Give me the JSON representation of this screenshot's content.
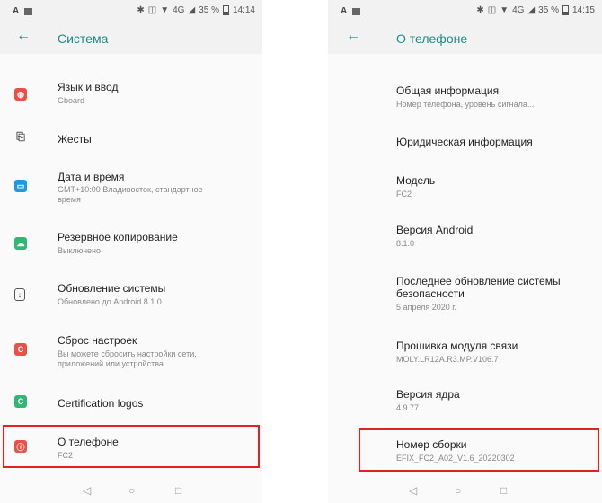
{
  "left": {
    "status": {
      "left_a": "A",
      "network": "4G",
      "battery": "35 %",
      "time": "14:14"
    },
    "title": "Система",
    "items": [
      {
        "title": "Язык и ввод",
        "sub": "Gboard",
        "icon": "globe-icon",
        "color": "#e8504a"
      },
      {
        "title": "Жесты",
        "icon": "gesture-icon",
        "color": "#666666"
      },
      {
        "title": "Дата и время",
        "sub": "GMT+10:00 Владивосток, стандартное",
        "sub2": "время",
        "icon": "clock-icon",
        "color": "#1e9be0"
      },
      {
        "title": "Резервное копирование",
        "sub": "Выключено",
        "icon": "backup-icon",
        "color": "#2eb873"
      },
      {
        "title": "Обновление системы",
        "sub": "Обновлено до Android 8.1.0",
        "icon": "update-icon",
        "color": "#555555"
      },
      {
        "title": "Сброс настроек",
        "sub": "Вы можете сбросить настройки сети,",
        "sub2": "приложений или устройства",
        "icon": "reset-icon",
        "color": "#e8504a"
      },
      {
        "title": "Certification logos",
        "icon": "certification-icon",
        "color": "#2eb873"
      },
      {
        "title": "О телефоне",
        "sub": "FC2",
        "icon": "info-icon",
        "color": "#e8504a"
      }
    ]
  },
  "right": {
    "status": {
      "left_a": "A",
      "network": "4G",
      "battery": "35 %",
      "time": "14:15"
    },
    "title": "О телефоне",
    "items": [
      {
        "title": "Общая информация",
        "sub": "Номер телефона, уровень сигнала..."
      },
      {
        "title": "Юридическая информация"
      },
      {
        "title": "Модель",
        "sub": "FC2"
      },
      {
        "title": "Версия Android",
        "sub": "8.1.0"
      },
      {
        "title": "Последнее обновление системы",
        "title2": "безопасности",
        "sub": "5 апреля 2020 г."
      },
      {
        "title": "Прошивка модуля связи",
        "sub": "MOLY.LR12A.R3.MP.V106.7"
      },
      {
        "title": "Версия ядра",
        "sub": "4.9.77"
      },
      {
        "title": "Номер сборки",
        "sub": "EFIX_FC2_A02_V1.6_20220302"
      }
    ]
  },
  "colors": {
    "accent": "#1a8f84",
    "highlight": "#e0231f"
  }
}
